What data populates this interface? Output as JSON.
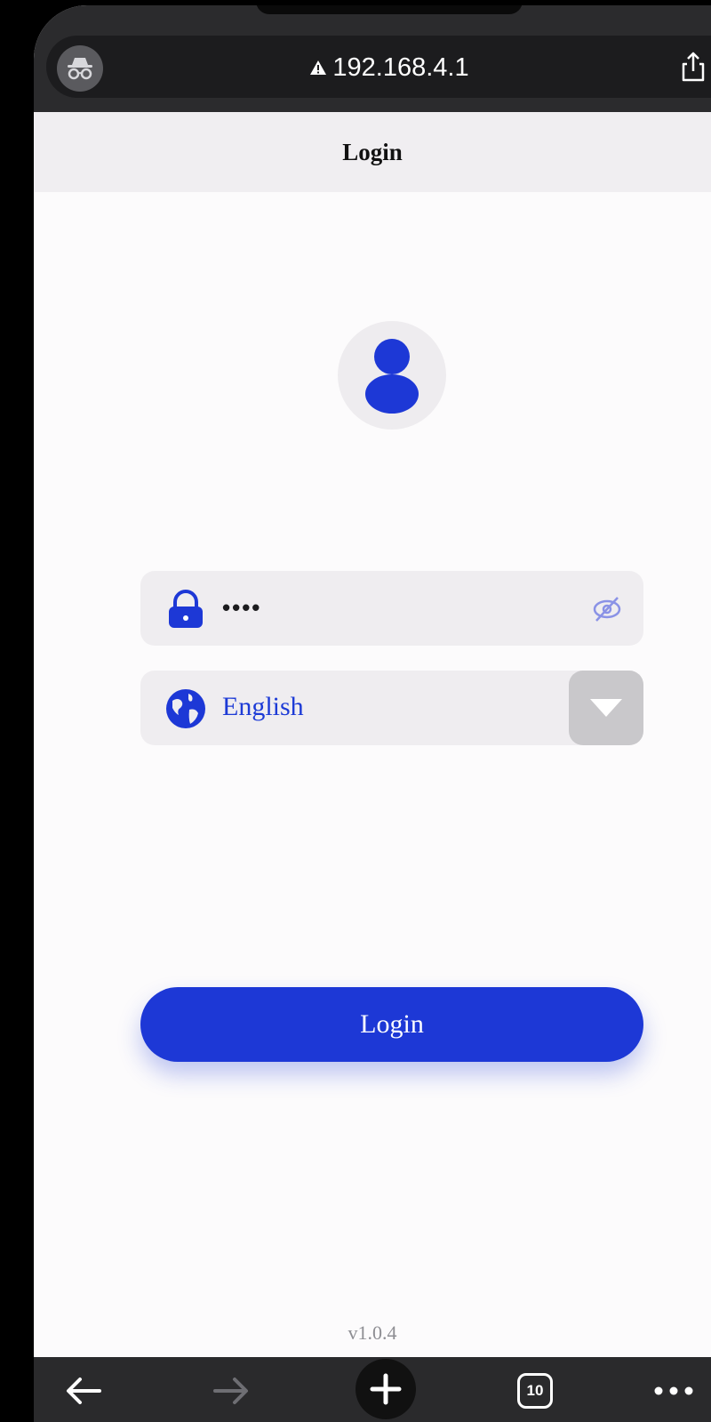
{
  "browser": {
    "url": "192.168.4.1",
    "tab_count": "10"
  },
  "header": {
    "title": "Login"
  },
  "form": {
    "password_value": "••••",
    "language_value": "English",
    "login_label": "Login"
  },
  "footer": {
    "version": "v1.0.4"
  },
  "colors": {
    "accent": "#1d38d6",
    "field_bg": "#efedf0",
    "chrome_bg": "#2a2a2c"
  },
  "icons": [
    "incognito-icon",
    "warning-icon",
    "share-icon",
    "user-icon",
    "lock-icon",
    "eye-off-icon",
    "globe-icon",
    "chevron-down-icon",
    "back-arrow-icon",
    "forward-arrow-icon",
    "new-tab-icon",
    "tabs-icon",
    "more-icon"
  ]
}
